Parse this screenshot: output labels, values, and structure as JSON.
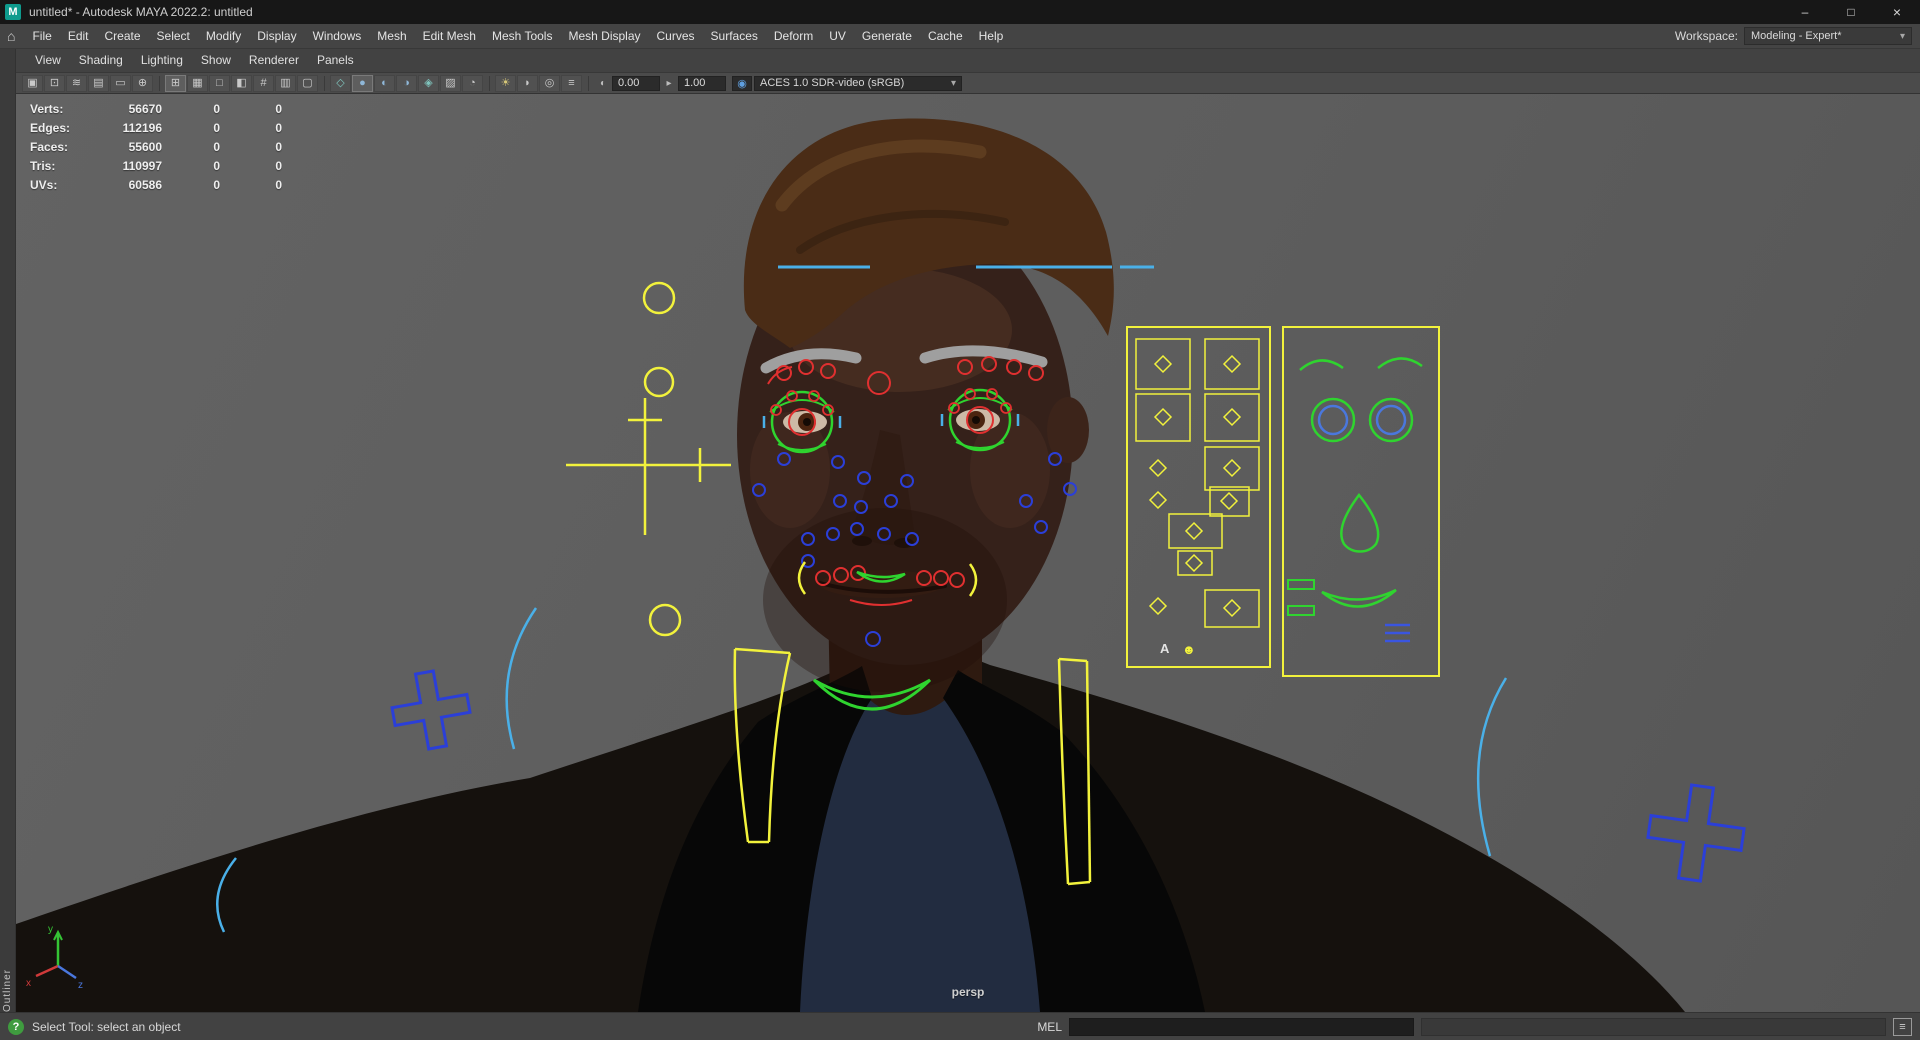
{
  "colors": {
    "accent_yellow": "#f2f23c",
    "accent_green": "#2fd42f",
    "accent_blue": "#2b3fd8",
    "accent_cyan": "#4ab0e8",
    "accent_red": "#e03030",
    "viewport_gray": "#5d5d5d",
    "ui_dark": "#444444"
  },
  "ui": {
    "chevron_down": "▾"
  },
  "title_bar": {
    "app_icon": "M",
    "title": "untitled* - Autodesk MAYA 2022.2: untitled",
    "minimize": "–",
    "maximize": "□",
    "close": "×"
  },
  "menu_bar": {
    "home_glyph": "⌂",
    "items": [
      "File",
      "Edit",
      "Create",
      "Select",
      "Modify",
      "Display",
      "Windows",
      "Mesh",
      "Edit Mesh",
      "Mesh Tools",
      "Mesh Display",
      "Curves",
      "Surfaces",
      "Deform",
      "UV",
      "Generate",
      "Cache",
      "Help"
    ],
    "workspace_label": "Workspace:",
    "workspace_value": "Modeling - Expert*"
  },
  "panel_menu": {
    "items": [
      "View",
      "Shading",
      "Lighting",
      "Show",
      "Renderer",
      "Panels"
    ]
  },
  "toolbar": {
    "icons": [
      {
        "name": "select-camera-icon",
        "glyph": "▣"
      },
      {
        "name": "lock-camera-icon",
        "glyph": "⊡"
      },
      {
        "name": "camera-attributes-icon",
        "glyph": "≋"
      },
      {
        "name": "bookmarks-icon",
        "glyph": "▤"
      },
      {
        "name": "image-plane-icon",
        "glyph": "▭"
      },
      {
        "name": "two-d-pan-zoom-icon",
        "glyph": "⊕"
      },
      {
        "name": "grid-icon",
        "glyph": "⊞"
      },
      {
        "name": "film-gate-icon",
        "glyph": "▦"
      },
      {
        "name": "resolution-gate-icon",
        "glyph": "□"
      },
      {
        "name": "gate-mask-icon",
        "glyph": "◧"
      },
      {
        "name": "field-chart-icon",
        "glyph": "#"
      },
      {
        "name": "safe-action-icon",
        "glyph": "▥"
      },
      {
        "name": "safe-title-icon",
        "glyph": "▢"
      },
      {
        "name": "wireframe-icon",
        "glyph": "◇"
      },
      {
        "name": "smooth-shade-icon",
        "glyph": "●"
      },
      {
        "name": "textured-icon",
        "glyph": "◐"
      },
      {
        "name": "use-default-material-icon",
        "glyph": "◑"
      },
      {
        "name": "wireframe-on-shaded-icon",
        "glyph": "◈"
      },
      {
        "name": "xray-icon",
        "glyph": "▨"
      },
      {
        "name": "isolate-select-icon",
        "glyph": "◔"
      },
      {
        "name": "lighting-icon",
        "glyph": "☀"
      },
      {
        "name": "shadows-icon",
        "glyph": "◗"
      },
      {
        "name": "occlusion-icon",
        "glyph": "◎"
      },
      {
        "name": "motion-blur-icon",
        "glyph": "≡"
      }
    ],
    "exposure": {
      "glyph": "◐",
      "value": "0.00"
    },
    "gamma": {
      "glyph": "▸",
      "value": "1.00"
    },
    "color_management_glyph": "◉",
    "colorspace_value": "ACES 1.0 SDR-video (sRGB)"
  },
  "outliner": {
    "label": "Outliner"
  },
  "hud": {
    "rows": [
      {
        "label": "Verts:",
        "value": "56670",
        "sel": "0",
        "hilite": "0"
      },
      {
        "label": "Edges:",
        "value": "112196",
        "sel": "0",
        "hilite": "0"
      },
      {
        "label": "Faces:",
        "value": "55600",
        "sel": "0",
        "hilite": "0"
      },
      {
        "label": "Tris:",
        "value": "110997",
        "sel": "0",
        "hilite": "0"
      },
      {
        "label": "UVs:",
        "value": "60586",
        "sel": "0",
        "hilite": "0"
      }
    ]
  },
  "viewport": {
    "camera_label": "persp",
    "picker": {
      "letter_a": "A",
      "smiley": "☻"
    },
    "axis": {
      "x": "x",
      "y": "y",
      "z": "z"
    }
  },
  "status_bar": {
    "help_glyph": "?",
    "tool_help": "Select Tool: select an object",
    "command_label": "MEL"
  }
}
